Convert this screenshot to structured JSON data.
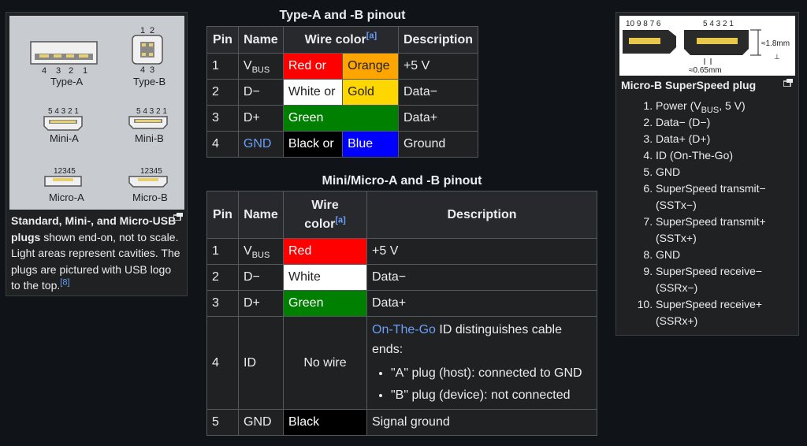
{
  "left_figure": {
    "plug_labels": {
      "type_a": "Type-A",
      "type_a_pins": [
        "4",
        "3",
        "2",
        "1"
      ],
      "type_b": "Type-B",
      "type_b_pins_top": [
        "1",
        "2"
      ],
      "type_b_pins_bottom": [
        "4",
        "3"
      ],
      "mini_a": "Mini-A",
      "mini_b": "Mini-B",
      "mini_pins": "5 4 3 2 1",
      "micro_a": "Micro-A",
      "micro_b": "Micro-B",
      "micro_pins": "12345"
    },
    "caption_bold": "Standard, Mini-, and Micro-USB plugs",
    "caption_text": " shown end-on, not to scale. Light areas represent cavities. The plugs are pictured with USB logo to the top.",
    "caption_ref": "[8]"
  },
  "table_ab": {
    "title": "Type-A and -B pinout",
    "headers": {
      "pin": "Pin",
      "name": "Name",
      "wire": "Wire color",
      "wire_note": "[a]",
      "desc": "Description"
    },
    "rows": [
      {
        "pin": "1",
        "name_main": "V",
        "name_sub": "BUS",
        "wire1": "Red or",
        "wire2": "Orange",
        "desc": "+5 V"
      },
      {
        "pin": "2",
        "name": "D−",
        "wire1": "White or",
        "wire2": "Gold",
        "desc": "Data−"
      },
      {
        "pin": "3",
        "name": "D+",
        "wire": "Green",
        "desc": "Data+"
      },
      {
        "pin": "4",
        "name": "GND",
        "wire1": "Black or",
        "wire2": "Blue",
        "desc": "Ground"
      }
    ]
  },
  "table_mini": {
    "title": "Mini/Micro-A and -B pinout",
    "headers": {
      "pin": "Pin",
      "name": "Name",
      "wire_l1": "Wire",
      "wire_l2": "color",
      "wire_note": "[a]",
      "desc": "Description"
    },
    "rows": [
      {
        "pin": "1",
        "name_main": "V",
        "name_sub": "BUS",
        "wire": "Red",
        "desc": "+5 V"
      },
      {
        "pin": "2",
        "name": "D−",
        "wire": "White",
        "desc": "Data−"
      },
      {
        "pin": "3",
        "name": "D+",
        "wire": "Green",
        "desc": "Data+"
      },
      {
        "pin": "4",
        "name": "ID",
        "wire": "No wire",
        "desc_link": "On-The-Go",
        "desc_text": " ID distinguishes cable ends:",
        "bullets": [
          "\"A\" plug (host): connected to GND",
          "\"B\" plug (device): not connected"
        ]
      },
      {
        "pin": "5",
        "name": "GND",
        "wire": "Black",
        "desc": "Signal ground"
      }
    ]
  },
  "right_figure": {
    "pins_left": "10 9 8 7 6",
    "pins_right": "5 4 3 2 1",
    "dim_height": "≈1.8mm",
    "dim_width": "≈0.65mm",
    "caption_title": "Micro-B SuperSpeed plug",
    "list": [
      {
        "main": "Power (V",
        "sub": "BUS",
        "tail": ", 5 V)"
      },
      {
        "text": "Data− (D−)"
      },
      {
        "text": "Data+ (D+)"
      },
      {
        "text": "ID (On-The-Go)"
      },
      {
        "text": "GND"
      },
      {
        "text": "SuperSpeed transmit− (SSTx−)"
      },
      {
        "text": "SuperSpeed transmit+ (SSTx+)"
      },
      {
        "text": "GND"
      },
      {
        "text": "SuperSpeed receive− (SSRx−)"
      },
      {
        "text": "SuperSpeed receive+ (SSRx+)"
      }
    ]
  },
  "colors": {
    "background": "#101418",
    "link": "#6b9ef8",
    "red": "#ff0000",
    "orange": "#ffa500",
    "white": "#ffffff",
    "gold": "#ffd700",
    "green": "#008000",
    "black": "#000000",
    "blue": "#0000ff"
  }
}
